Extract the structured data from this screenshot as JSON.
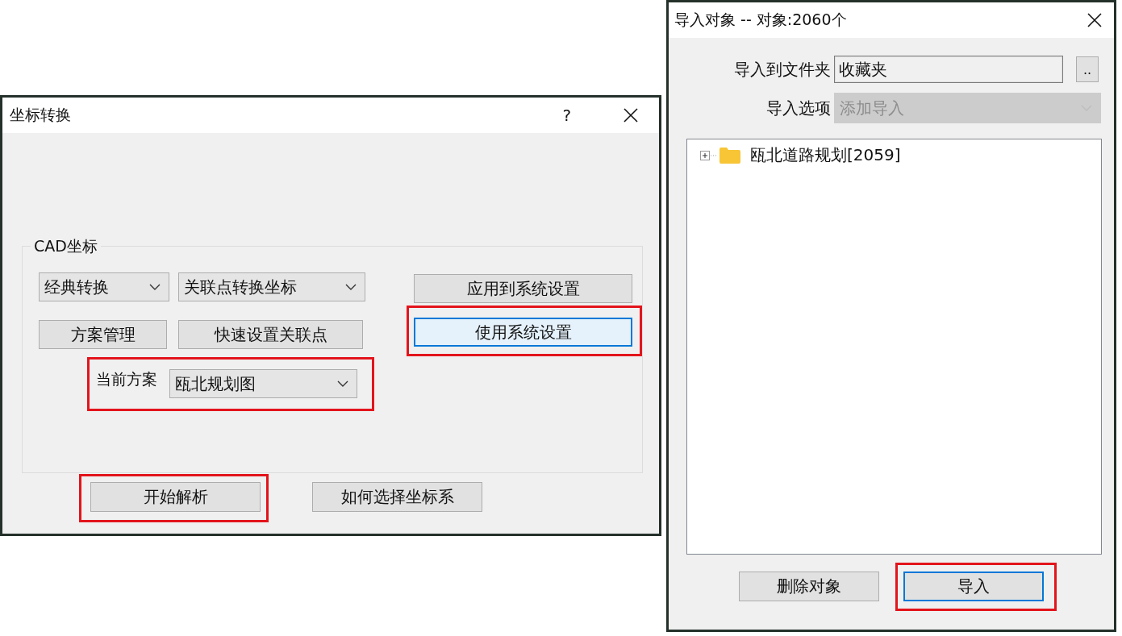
{
  "coordinate_dialog": {
    "title": "坐标转换",
    "help": "?",
    "group": {
      "label": "CAD坐标"
    },
    "dropdowns": [
      {
        "value": "经典转换"
      },
      {
        "value": "关联点转换坐标"
      }
    ],
    "buttons": [
      {
        "label": "方案管理",
        "focused": false,
        "hovered": false
      },
      {
        "label": "快速设置关联点",
        "focused": false,
        "hovered": false
      }
    ],
    "system_buttons": [
      {
        "label": "应用到系统设置",
        "focused": false,
        "hovered": false,
        "highlighted": false
      },
      {
        "label": "使用系统设置",
        "focused": true,
        "hovered": true,
        "highlighted": true
      }
    ],
    "current_scheme": {
      "label": "当前方案",
      "value": "瓯北规划图",
      "highlighted": true
    },
    "footer_buttons": [
      {
        "label": "开始解析",
        "focused": false,
        "hovered": false,
        "highlighted": true
      },
      {
        "label": "如何选择坐标系",
        "focused": false,
        "hovered": false,
        "highlighted": false
      }
    ]
  },
  "import_dialog": {
    "title": "导入对象 -- 对象:2060个",
    "folder": {
      "label": "导入到文件夹",
      "value": "收藏夹",
      "browse": ".."
    },
    "option": {
      "label": "导入选项",
      "value": "添加导入",
      "disabled": true
    },
    "tree": [
      {
        "label": "瓯北道路规划[2059]",
        "expanded": false
      }
    ],
    "buttons": [
      {
        "label": "删除对象",
        "focused": false,
        "hovered": false,
        "highlighted": false
      },
      {
        "label": "导入",
        "focused": true,
        "hovered": false,
        "highlighted": true
      }
    ]
  }
}
